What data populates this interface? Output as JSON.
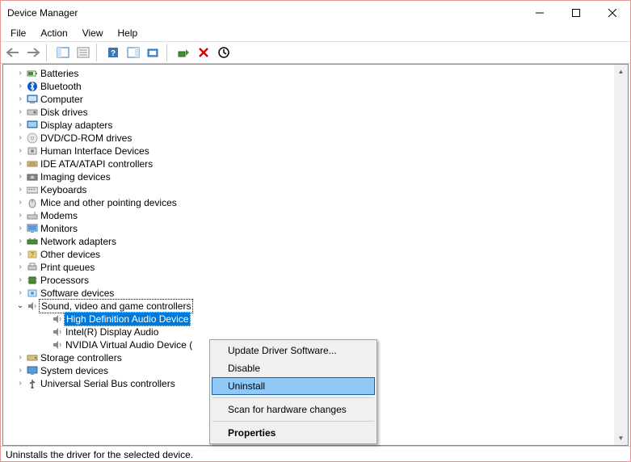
{
  "window": {
    "title": "Device Manager"
  },
  "menubar": [
    "File",
    "Action",
    "View",
    "Help"
  ],
  "tree": [
    {
      "label": "Batteries",
      "icon": "battery",
      "expanded": false,
      "level": 1
    },
    {
      "label": "Bluetooth",
      "icon": "bluetooth",
      "expanded": false,
      "level": 1
    },
    {
      "label": "Computer",
      "icon": "computer",
      "expanded": false,
      "level": 1
    },
    {
      "label": "Disk drives",
      "icon": "disk",
      "expanded": false,
      "level": 1
    },
    {
      "label": "Display adapters",
      "icon": "display",
      "expanded": false,
      "level": 1
    },
    {
      "label": "DVD/CD-ROM drives",
      "icon": "dvd",
      "expanded": false,
      "level": 1
    },
    {
      "label": "Human Interface Devices",
      "icon": "hid",
      "expanded": false,
      "level": 1
    },
    {
      "label": "IDE ATA/ATAPI controllers",
      "icon": "ide",
      "expanded": false,
      "level": 1
    },
    {
      "label": "Imaging devices",
      "icon": "imaging",
      "expanded": false,
      "level": 1
    },
    {
      "label": "Keyboards",
      "icon": "keyboard",
      "expanded": false,
      "level": 1
    },
    {
      "label": "Mice and other pointing devices",
      "icon": "mouse",
      "expanded": false,
      "level": 1
    },
    {
      "label": "Modems",
      "icon": "modem",
      "expanded": false,
      "level": 1
    },
    {
      "label": "Monitors",
      "icon": "monitor",
      "expanded": false,
      "level": 1
    },
    {
      "label": "Network adapters",
      "icon": "network",
      "expanded": false,
      "level": 1
    },
    {
      "label": "Other devices",
      "icon": "other",
      "expanded": false,
      "level": 1
    },
    {
      "label": "Print queues",
      "icon": "print",
      "expanded": false,
      "level": 1
    },
    {
      "label": "Processors",
      "icon": "processor",
      "expanded": false,
      "level": 1
    },
    {
      "label": "Software devices",
      "icon": "software",
      "expanded": false,
      "level": 1
    },
    {
      "label": "Sound, video and game controllers",
      "icon": "sound",
      "expanded": true,
      "level": 1,
      "focused": true
    },
    {
      "label": "High Definition Audio Device",
      "icon": "speaker",
      "level": 2,
      "selected": true
    },
    {
      "label": "Intel(R) Display Audio",
      "icon": "speaker",
      "level": 2
    },
    {
      "label": "NVIDIA Virtual Audio Device (",
      "icon": "speaker",
      "level": 2
    },
    {
      "label": "Storage controllers",
      "icon": "storage",
      "expanded": false,
      "level": 1
    },
    {
      "label": "System devices",
      "icon": "system",
      "expanded": false,
      "level": 1
    },
    {
      "label": "Universal Serial Bus controllers",
      "icon": "usb",
      "expanded": false,
      "level": 1
    }
  ],
  "context_menu": [
    {
      "label": "Update Driver Software...",
      "type": "item"
    },
    {
      "label": "Disable",
      "type": "item"
    },
    {
      "label": "Uninstall",
      "type": "item",
      "highlighted": true
    },
    {
      "type": "sep"
    },
    {
      "label": "Scan for hardware changes",
      "type": "item"
    },
    {
      "type": "sep"
    },
    {
      "label": "Properties",
      "type": "item",
      "bold": true
    }
  ],
  "statusbar": "Uninstalls the driver for the selected device."
}
